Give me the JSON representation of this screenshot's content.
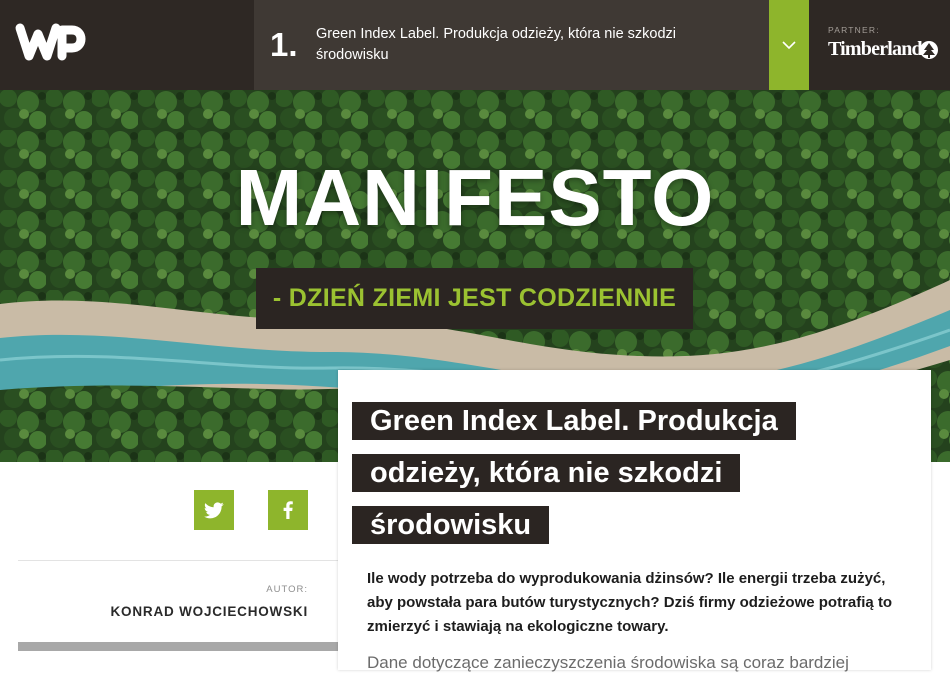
{
  "header": {
    "logo_alt": "WP",
    "article_number": "1.",
    "article_title": "Green Index Label. Produkcja odzieży, która nie szkodzi środowisku",
    "partner_label": "PARTNER:",
    "partner_name": "Timberland",
    "accent_color": "#8eb52c"
  },
  "hero": {
    "title": "MANIFESTO",
    "subtitle": "- DZIEŃ ZIEMI JEST CODZIENNIE"
  },
  "share": {
    "twitter_icon": "twitter-icon",
    "facebook_icon": "facebook-icon"
  },
  "author": {
    "label": "AUTOR:",
    "name": "KONRAD WOJCIECHOWSKI"
  },
  "article": {
    "title": "Green Index Label. Produkcja odzieży, która nie szkodzi środowisku",
    "lead": "Ile wody potrzeba do wyprodukowania dżinsów? Ile energii trzeba zużyć, aby powstała para butów turystycznych? Dziś firmy odzieżowe potrafią to zmierzyć i stawiają na ekologiczne towary.",
    "body": "Dane dotyczące zanieczyszczenia środowiska są coraz bardziej"
  }
}
